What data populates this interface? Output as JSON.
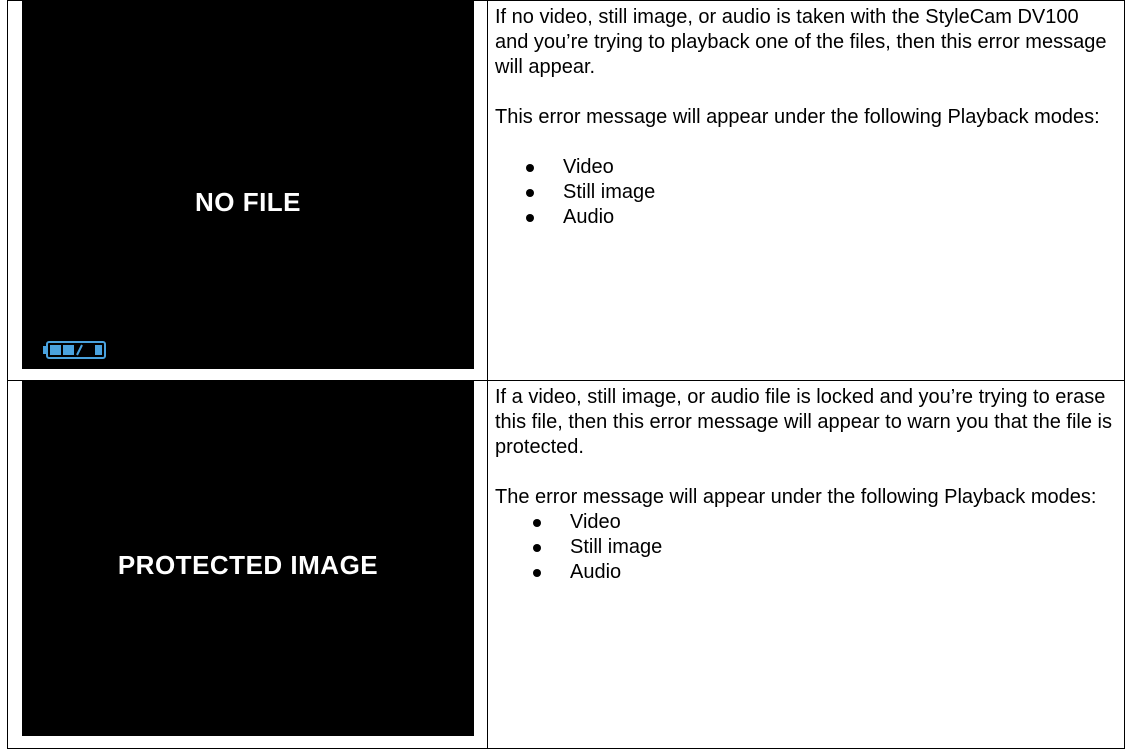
{
  "rows": [
    {
      "screen_message": "NO FILE",
      "paragraphs": [
        "If no video, still image, or audio is taken with the StyleCam DV100 and you’re trying to playback one of the files, then this error message will appear.",
        "This error message will appear under the following Playback modes:"
      ],
      "modes": [
        "Video",
        "Still image",
        "Audio"
      ],
      "battery_icon": "battery-icon"
    },
    {
      "screen_message": "PROTECTED IMAGE",
      "paragraphs": [
        "If a video, still image, or audio file is locked and you’re trying to erase this file, then this error message will appear to warn you that the file is protected.",
        "The error message will appear under the following Playback modes:"
      ],
      "modes": [
        "Video",
        "Still image",
        "Audio"
      ]
    }
  ],
  "colors": {
    "screen_background": "#000000",
    "screen_text": "#ffffff",
    "battery_fill": "#4aa3df",
    "border": "#000000"
  }
}
